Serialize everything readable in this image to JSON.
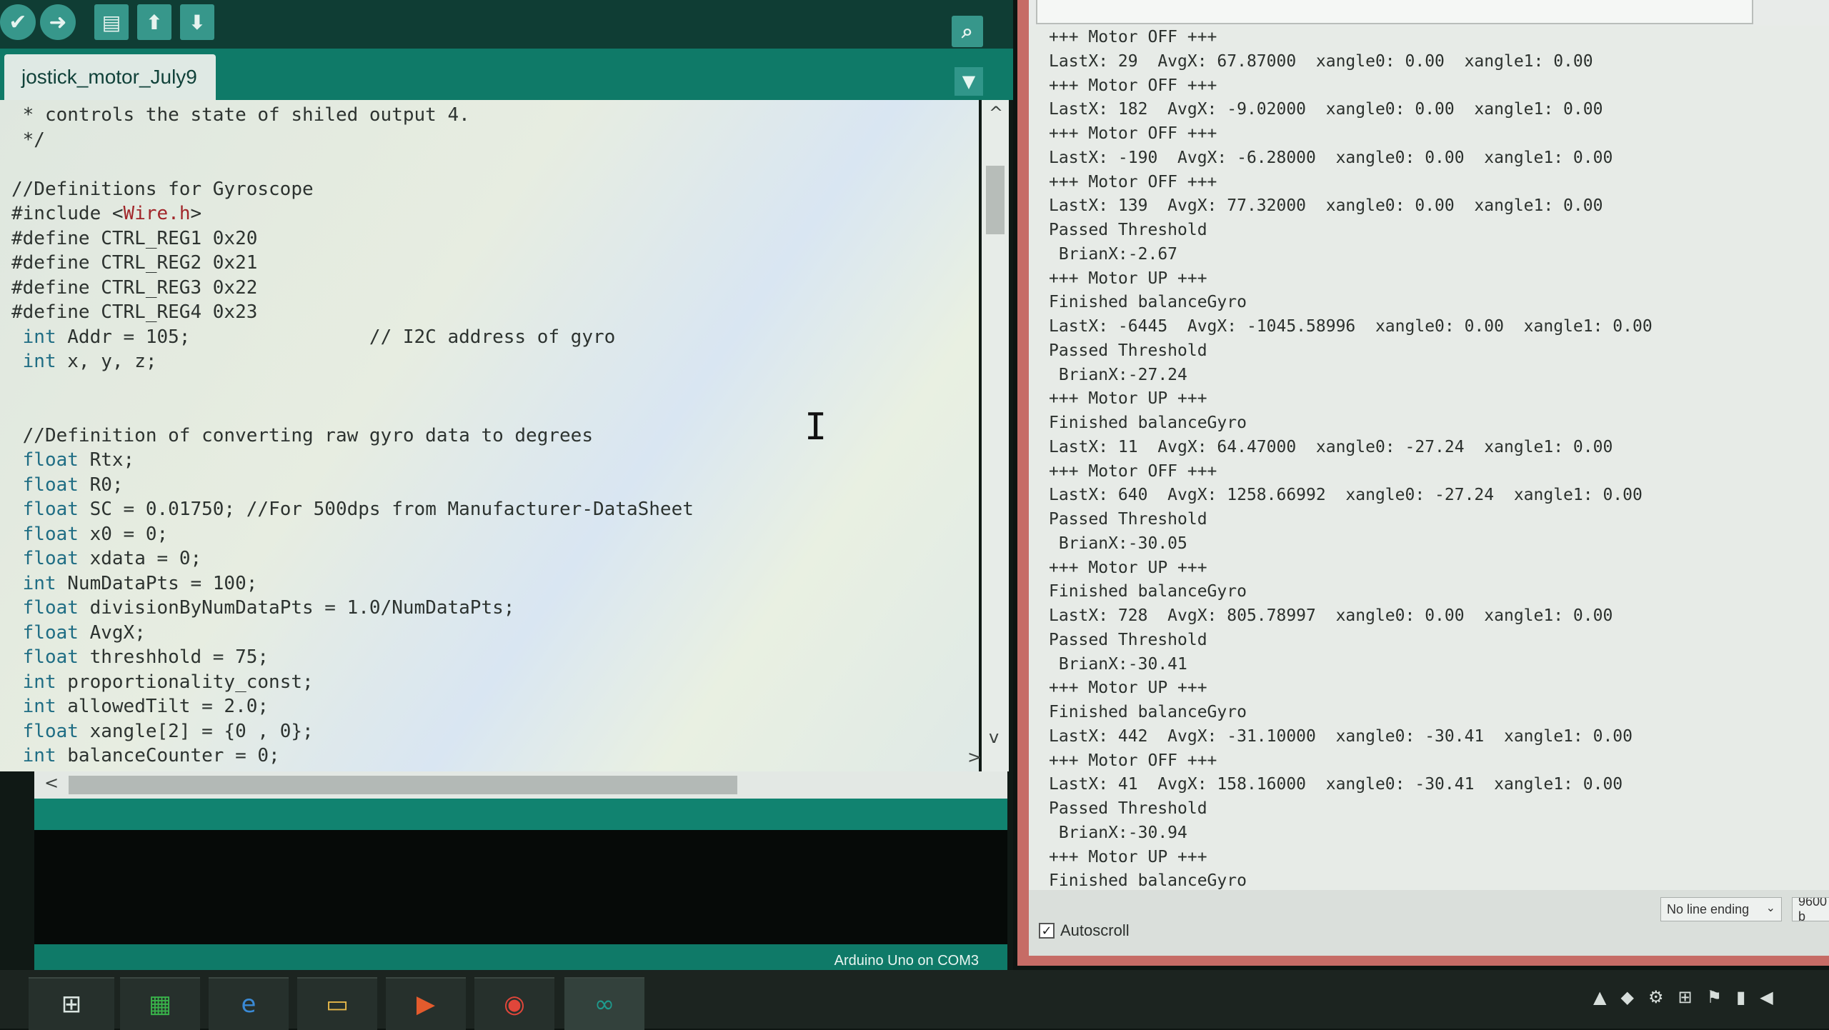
{
  "ide": {
    "toolbar": {
      "verify_icon": "✔",
      "upload_icon": "➜",
      "new_icon": "▤",
      "open_icon": "⬆",
      "save_icon": "⬇",
      "serial_monitor_icon": "⌕"
    },
    "tab_label": "jostick_motor_July9",
    "tab_menu_icon": "▼",
    "code_lines": [
      " * controls the state of shiled output 4.",
      " */",
      "",
      "//Definitions for Gyroscope",
      "#include <Wire.h>",
      "#define CTRL_REG1 0x20",
      "#define CTRL_REG2 0x21",
      "#define CTRL_REG3 0x22",
      "#define CTRL_REG4 0x23",
      " int Addr = 105;                // I2C address of gyro",
      " int x, y, z;",
      "",
      "",
      " //Definition of converting raw gyro data to degrees",
      " float Rtx;",
      " float R0;",
      " float SC = 0.01750; //For 500dps from Manufacturer-DataSheet",
      " float x0 = 0;",
      " float xdata = 0;",
      " int NumDataPts = 100;",
      " float divisionByNumDataPts = 1.0/NumDataPts;",
      " float AvgX;",
      " float threshhold = 75;",
      " int proportionality_const;",
      " int allowedTilt = 2.0;",
      " float xangle[2] = {0 , 0};",
      " int balanceCounter = 0;"
    ],
    "scroll_up": "^",
    "scroll_down": "v",
    "scroll_left": "<",
    "scroll_right": ">",
    "board": "Arduino Uno on COM3"
  },
  "serial": {
    "lines": [
      "+++ Motor OFF +++",
      "LastX: 29  AvgX: 67.87000  xangle0: 0.00  xangle1: 0.00",
      "+++ Motor OFF +++",
      "LastX: 182  AvgX: -9.02000  xangle0: 0.00  xangle1: 0.00",
      "+++ Motor OFF +++",
      "LastX: -190  AvgX: -6.28000  xangle0: 0.00  xangle1: 0.00",
      "+++ Motor OFF +++",
      "LastX: 139  AvgX: 77.32000  xangle0: 0.00  xangle1: 0.00",
      "Passed Threshold",
      " BrianX:-2.67",
      "+++ Motor UP +++",
      "Finished balanceGyro",
      "LastX: -6445  AvgX: -1045.58996  xangle0: 0.00  xangle1: 0.00",
      "Passed Threshold",
      " BrianX:-27.24",
      "+++ Motor UP +++",
      "Finished balanceGyro",
      "LastX: 11  AvgX: 64.47000  xangle0: -27.24  xangle1: 0.00",
      "+++ Motor OFF +++",
      "LastX: 640  AvgX: 1258.66992  xangle0: -27.24  xangle1: 0.00",
      "Passed Threshold",
      " BrianX:-30.05",
      "+++ Motor UP +++",
      "Finished balanceGyro",
      "LastX: 728  AvgX: 805.78997  xangle0: 0.00  xangle1: 0.00",
      "Passed Threshold",
      " BrianX:-30.41",
      "+++ Motor UP +++",
      "Finished balanceGyro",
      "LastX: 442  AvgX: -31.10000  xangle0: -30.41  xangle1: 0.00",
      "+++ Motor OFF +++",
      "LastX: 41  AvgX: 158.16000  xangle0: -30.41  xangle1: 0.00",
      "Passed Threshold",
      " BrianX:-30.94",
      "+++ Motor UP +++",
      "Finished balanceGyro"
    ],
    "autoscroll_label": "Autoscroll",
    "autoscroll_checked": "✓",
    "line_ending": "No line ending",
    "line_ending_chevron": "⌄",
    "baud": "9600 b"
  },
  "taskbar": {
    "start_icon": "⊞",
    "apps": [
      "▦",
      "e",
      "▭",
      "▶",
      "◉",
      "∞"
    ],
    "tray": [
      "▲",
      "◆",
      "⚙",
      "⊞",
      "⚑",
      "▮",
      "◀"
    ]
  }
}
